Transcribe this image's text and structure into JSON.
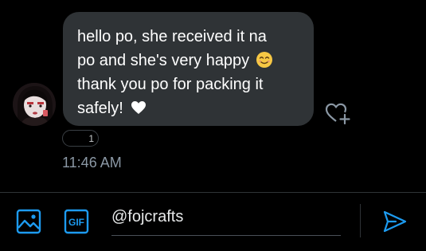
{
  "conversation": {
    "message": {
      "text": "hello po, she received it na\npo and she's very happy",
      "text_line3": "thank you po for packing it",
      "text_line4": "safely!",
      "emoji_1": "smiling-face-icon",
      "emoji_2": "heart-icon"
    },
    "reaction": {
      "count": "1"
    },
    "timestamp": "11:46 AM"
  },
  "composer": {
    "input_value": "@fojcrafts",
    "icons": [
      "image-icon",
      "gif-icon",
      "send-icon"
    ]
  },
  "colors": {
    "background": "#000000",
    "bubble": "#2f3336",
    "accent": "#1d9bf0",
    "muted_text": "#8b98a5"
  }
}
